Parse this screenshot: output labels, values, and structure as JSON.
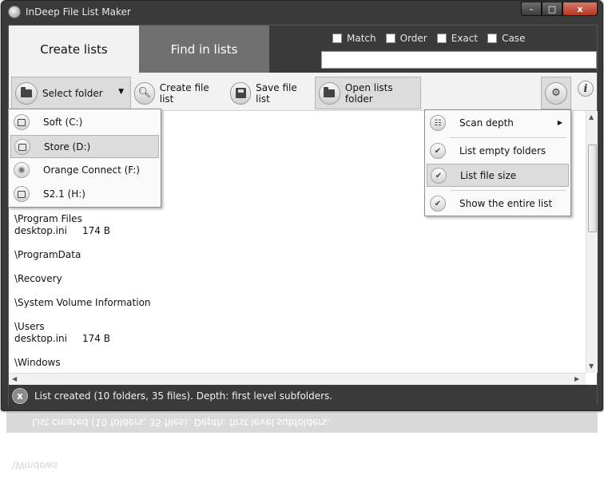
{
  "app": {
    "title": "InDeep File List Maker"
  },
  "window_controls": {
    "minimize": "–",
    "maximize": "□",
    "close": "x"
  },
  "tabs": [
    {
      "label": "Create lists",
      "active": true
    },
    {
      "label": "Find in lists",
      "active": false
    }
  ],
  "search": {
    "options": [
      {
        "label": "Match",
        "checked": false
      },
      {
        "label": "Order",
        "checked": false
      },
      {
        "label": "Exact",
        "checked": false
      },
      {
        "label": "Case",
        "checked": false
      }
    ],
    "value": ""
  },
  "toolbar": {
    "select_folder": "Select folder",
    "create_file_list": "Create file list",
    "save_file_list": "Save file list",
    "open_lists_folder": "Open lists folder",
    "info": "i"
  },
  "content_lines": [
    "\\Program Files",
    "desktop.ini     174 B",
    "",
    "\\ProgramData",
    "",
    "\\Recovery",
    "",
    "\\System Volume Information",
    "",
    "\\Users",
    "desktop.ini     174 B",
    "",
    "\\Windows"
  ],
  "drive_menu": [
    {
      "label": "Soft (C:)",
      "icon": "drive-icon",
      "selected": false
    },
    {
      "label": "Store (D:)",
      "icon": "drive-icon",
      "selected": true
    },
    {
      "label": "Orange Connect (F:)",
      "icon": "disc-icon",
      "selected": false
    },
    {
      "label": "S2.1 (H:)",
      "icon": "drive-icon",
      "selected": false
    }
  ],
  "settings_menu": [
    {
      "label": "Scan depth",
      "icon": "tree-icon",
      "submenu": true,
      "selected": false
    },
    {
      "label": "List empty folders",
      "icon": "check-icon",
      "checked": true,
      "selected": false
    },
    {
      "label": "List file size",
      "icon": "check-icon",
      "checked": true,
      "selected": true
    },
    {
      "label": "Show the entire list",
      "icon": "check-icon",
      "checked": true,
      "selected": false
    }
  ],
  "status": {
    "text": "List created (10 folders, 35 files).  Depth: first level subfolders.",
    "icon": "x"
  },
  "reflection": {
    "status_text": "List created (10 folders, 35 files).  Depth: first level subfolders.",
    "line": "\\Windows"
  },
  "colors": {
    "chrome": "#3a3a3a",
    "inactive_tab": "#707070",
    "toolbar": "#f2f2f2",
    "selection": "#dcdcdc"
  }
}
